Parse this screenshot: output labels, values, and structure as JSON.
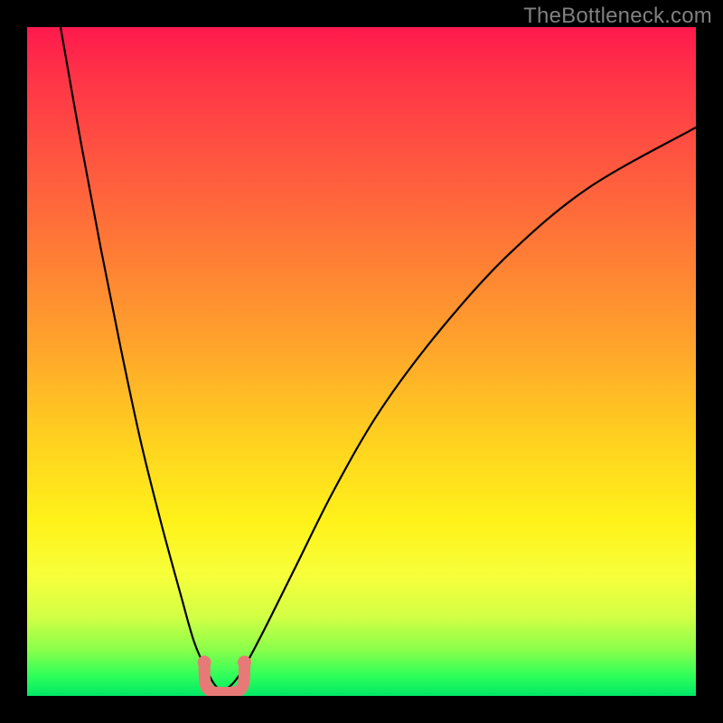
{
  "watermark": "TheBottleneck.com",
  "chart_data": {
    "type": "line",
    "title": "",
    "xlabel": "",
    "ylabel": "",
    "xlim": [
      0,
      100
    ],
    "ylim": [
      0,
      100
    ],
    "grid": false,
    "gradient": {
      "orientation": "vertical",
      "top_color": "#ff1a4d",
      "bottom_color": "#00e865",
      "meaning": "top=bad, bottom=good"
    },
    "series": [
      {
        "name": "bottleneck-curve",
        "x": [
          5,
          8,
          11,
          14,
          17,
          20,
          23,
          25,
          27,
          28.5,
          30,
          32,
          35,
          40,
          46,
          53,
          62,
          72,
          84,
          100
        ],
        "y": [
          100,
          83,
          67,
          52,
          38,
          26,
          15,
          8,
          3.5,
          1.2,
          1.2,
          3.5,
          9,
          19,
          31,
          43,
          55,
          66,
          76,
          85
        ]
      }
    ],
    "annotations": [
      {
        "name": "optimal-valley",
        "type": "highlight",
        "color": "#e77a76",
        "x_range": [
          26.5,
          32.5
        ],
        "y_range": [
          1,
          5
        ]
      }
    ]
  }
}
